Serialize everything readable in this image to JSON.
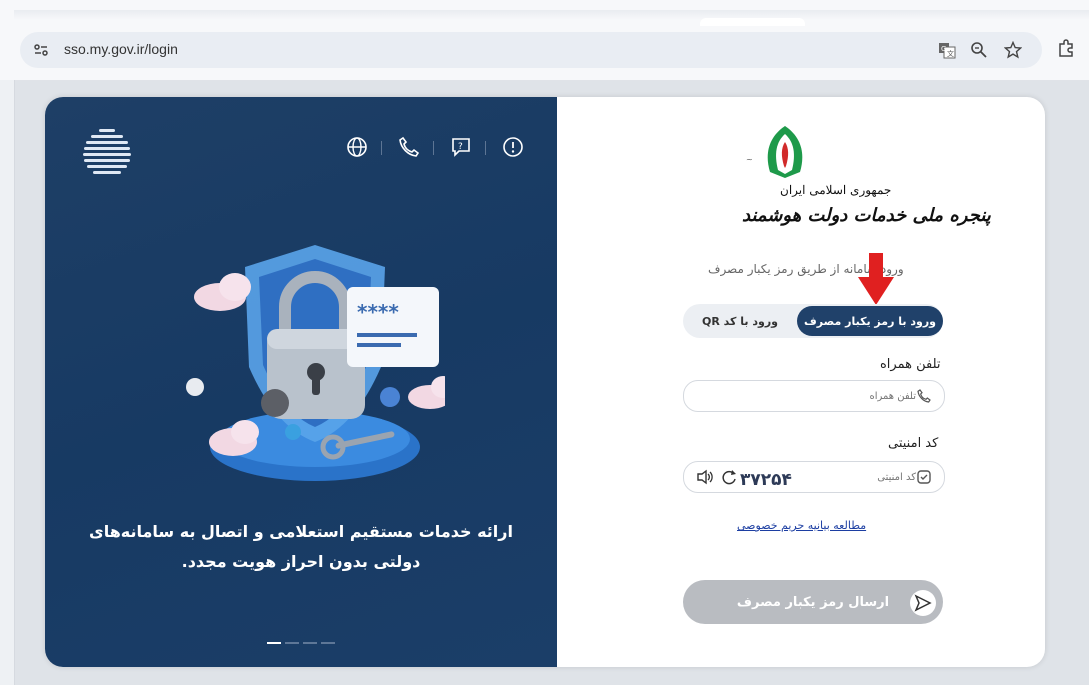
{
  "browser": {
    "url": "sso.my.gov.ir/login",
    "icons": [
      "site-settings-icon",
      "translate-icon",
      "zoom-icon",
      "star-icon",
      "extensions-icon"
    ]
  },
  "panel": {
    "top_icons": [
      "globe-icon",
      "phone-icon",
      "help-chat-icon",
      "info-icon"
    ],
    "caption_line1": "ارائه خدمات مستقیم استعلامی و اتصال به سامانه‌های",
    "caption_line2": "دولتی بدون احراز هویت مجدد.",
    "password_mask": "****",
    "slides_total": 4,
    "slide_active": 1
  },
  "header": {
    "emblem_caption": "جمهوری اسلامی ایران",
    "title": "پنجره ملی خدمات دولت هوشمند",
    "subtitle": "ورود      سامانه از طریق رمز یکبار مصرف"
  },
  "tabs": {
    "otp_label": "ورود با رمز یکبار مصرف",
    "qr_label": "ورود با کد QR"
  },
  "form": {
    "phone_label": "تلفن همراه",
    "phone_placeholder": "تلفن همراه",
    "captcha_label": "کد امنیتی",
    "captcha_placeholder": "کد امنیتی",
    "captcha_value": "۳۷۲۵۴",
    "privacy_link": "مطالعه بیانیه حریم خصوصی",
    "submit_label": "ارسال رمز یکبار مصرف"
  },
  "colors": {
    "panel": "#1b3e68",
    "tab_active": "#20416a",
    "link": "#1c3ea2",
    "arrow": "#e02020",
    "submit_disabled": "#b9bcc1"
  }
}
